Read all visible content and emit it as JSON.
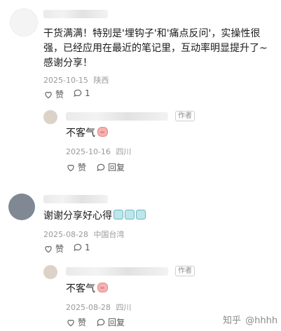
{
  "comments": [
    {
      "text": "干货满满！特别是'埋钩子'和'痛点反问'，实操性很强，已经应用在最近的笔记里，互动率明显提升了~感谢分享！",
      "date": "2025-10-15",
      "location": "陕西",
      "like_label": "赞",
      "reply_count": "1",
      "reply": {
        "author_badge": "作者",
        "text": "不客气",
        "date": "2025-10-16",
        "location": "四川",
        "like_label": "赞",
        "reply_label": "回复"
      }
    },
    {
      "text": "谢谢分享好心得",
      "date": "2025-08-28",
      "location": "中国台湾",
      "like_label": "赞",
      "reply_count": "1",
      "reply": {
        "author_badge": "作者",
        "text": "不客气",
        "date": "2025-08-28",
        "location": "四川",
        "like_label": "赞",
        "reply_label": "回复"
      }
    }
  ],
  "watermark": {
    "brand": "知乎",
    "handle": "@hhhh"
  },
  "colors": {
    "text": "#1a1a1a",
    "meta": "#999999",
    "badge_border": "#cfcfcf"
  }
}
